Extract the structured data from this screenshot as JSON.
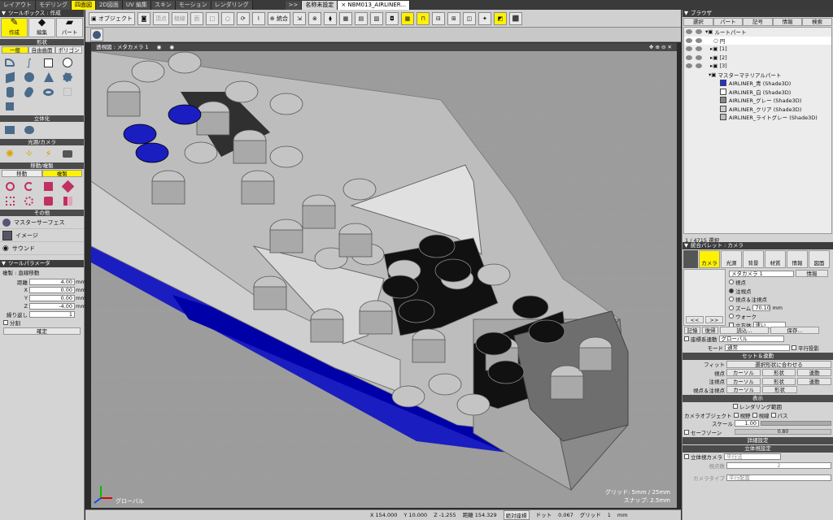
{
  "menu": {
    "tabs": [
      "レイアウト",
      "モデリング",
      "四面図",
      "2D図面",
      "UV 編集",
      "スキン",
      "モーション",
      "レンダリング"
    ],
    "more": ">>",
    "doc_tabs": [
      "名称未設定",
      "× NBM013_AIRLINER..."
    ]
  },
  "toolbox": {
    "title": "ツールボックス : 作成",
    "modes": [
      "作成",
      "編集",
      "パート"
    ],
    "shape_header": "形状",
    "shape_tabs": [
      "一般",
      "自由曲面",
      "ポリゴン"
    ],
    "solid_header": "立体化",
    "light_header": "光源/カメラ",
    "move_header": "移動/複製",
    "move_tabs": [
      "移動",
      "複製"
    ],
    "other_header": "その他",
    "other_items": [
      "マスターサーフェス",
      "イメージ",
      "サウンド"
    ]
  },
  "params": {
    "title": "ツールパラメータ",
    "subtitle": "複製 : 直線移動",
    "fields": [
      {
        "label": "距離",
        "value": "4.00",
        "unit": "mm"
      },
      {
        "label": "X",
        "value": "0.00",
        "unit": "mm"
      },
      {
        "label": "Y",
        "value": "0.00",
        "unit": "mm"
      },
      {
        "label": "Z",
        "value": "-4.00",
        "unit": "mm"
      },
      {
        "label": "繰り返し",
        "value": "1",
        "unit": ""
      }
    ],
    "split": "分割",
    "confirm": "確定"
  },
  "toolbar": {
    "object": "オブジェクト",
    "vertex": "頂点",
    "edge": "稜線",
    "face": "面",
    "merge": "統合"
  },
  "viewport": {
    "title": "透視図 : メタカメラ 1",
    "grid": "グリッド: 5mm / 25mm",
    "snap": "スナップ: 2.5mm",
    "axis": "グローバル"
  },
  "status": {
    "x": "X  154.000",
    "y": "Y  10.000",
    "z": "Z  -1.255",
    "dist": "距離  154.329",
    "coord": "絶対座標",
    "dot": "ドット",
    "dotval": "0.067",
    "grid": "グリッド",
    "gridval": "1",
    "unit": "mm"
  },
  "browser": {
    "title": "ブラウザ",
    "tabs": [
      "選択",
      "パート",
      "記号",
      "情報",
      "検索"
    ],
    "tree": [
      {
        "name": "ルートパート",
        "level": 0
      },
      {
        "name": "円",
        "level": 1,
        "sel": true
      },
      {
        "name": "[1]",
        "level": 1
      },
      {
        "name": "[2]",
        "level": 1
      },
      {
        "name": "[3]",
        "level": 1
      },
      {
        "name": "マスターマテリアルパート",
        "level": 1
      },
      {
        "name": "AIRLINER_青 (Shade3D)",
        "level": 2,
        "color": "#2233cc"
      },
      {
        "name": "AIRLINER_白 (Shade3D)",
        "level": 2,
        "color": "#ffffff"
      },
      {
        "name": "AIRLINER_グレー (Shade3D)",
        "level": 2,
        "color": "#888888"
      },
      {
        "name": "AIRLINER_クリア (Shade3D)",
        "level": 2,
        "color": "#cccccc"
      },
      {
        "name": "AIRLINER_ライトグレー (Shade3D)",
        "level": 2,
        "color": "#bbbbbb"
      }
    ],
    "count": "1 / 4715 選択"
  },
  "palette": {
    "title": "統合パレット : カメラ",
    "tabs": [
      "カメラ",
      "光源",
      "背景",
      "材質",
      "情報",
      "図面"
    ],
    "camera_name": "メタカメラ 1",
    "info": "情報",
    "options": [
      "視点",
      "注視点",
      "視点＆注視点",
      "ズーム",
      "ウォーク"
    ],
    "zoom_value": "70.10",
    "zoom_unit": "mm",
    "nav": [
      "<<",
      ">>"
    ],
    "cube": "立方体",
    "speed": "速い",
    "store": "記憶",
    "restore": "復帰",
    "load": "読込...",
    "save": "保存...",
    "coord_link": "座標系連動",
    "coord_val": "グローバル",
    "mode": "モード",
    "mode_val": "通常",
    "parallel": "平行投影",
    "set_header": "セット＆連動",
    "fit": "フィット",
    "fit_btn": "選択形状に合わせる",
    "rows": [
      {
        "label": "視点",
        "a": "カーソル",
        "b": "形状",
        "c": "連動"
      },
      {
        "label": "注視点",
        "a": "カーソル",
        "b": "形状",
        "c": "連動"
      },
      {
        "label": "視点＆注視点",
        "a": "カーソル",
        "b": "形状",
        "c": ""
      }
    ],
    "display_header": "表示",
    "render_range": "レンダリング範囲",
    "cam_obj": "カメラオブジェクト",
    "fov": "視野",
    "sight": "視線",
    "path": "パス",
    "scale": "スケール",
    "scale_val": "1.00",
    "safe": "セーフゾーン",
    "safe_val": "0.80",
    "detail_header": "詳細設定",
    "stereo_header": "立体視設定",
    "stereo": "立体視カメラ",
    "stereo_mode": "平行法",
    "eyes": "視点数",
    "eyes_val": "2",
    "cam_type": "カメラタイプ",
    "cam_type_val": "平行配置"
  }
}
